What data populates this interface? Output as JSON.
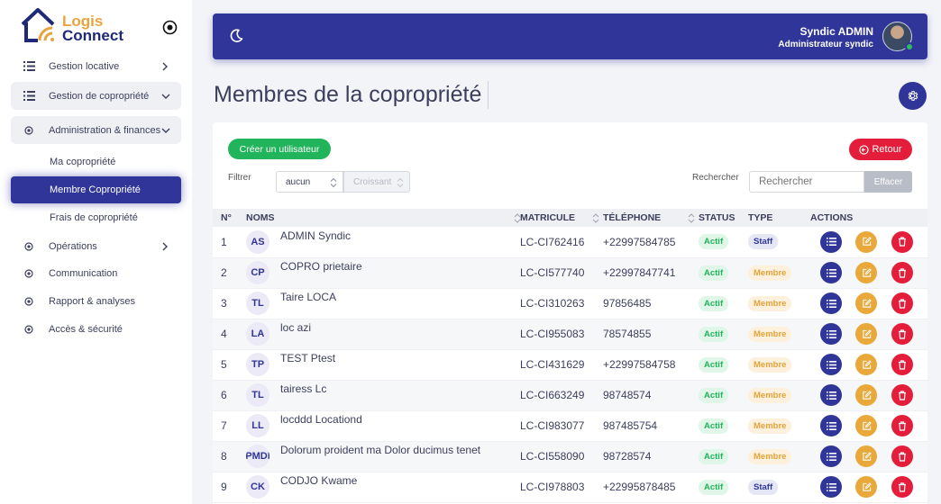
{
  "brand": {
    "line1": "Logis",
    "line2": "Connect"
  },
  "sidebar": {
    "items": [
      {
        "label": "Gestion locative"
      },
      {
        "label": "Gestion de copropriété"
      },
      {
        "label": "Administration & finances"
      },
      {
        "label": "Opérations"
      },
      {
        "label": "Communication"
      },
      {
        "label": "Rapport & analyses"
      },
      {
        "label": "Accès & sécurité"
      }
    ],
    "subitems": [
      {
        "label": "Ma copropriété"
      },
      {
        "label": "Membre Copropriété"
      },
      {
        "label": "Frais de copropriété"
      }
    ]
  },
  "header": {
    "user_name": "Syndic ADMIN",
    "user_role": "Administrateur syndic"
  },
  "page": {
    "title": "Membres de la copropriété"
  },
  "toolbar": {
    "create_label": "Créer un utilisateur",
    "back_label": "Retour",
    "filter_label": "Filtrer",
    "filter_value": "aucun",
    "order_value": "Croissant",
    "search_label": "Rechercher",
    "search_placeholder": "Rechercher",
    "clear_label": "Effacer"
  },
  "table": {
    "headers": [
      "N°",
      "NOMS",
      "MATRICULE",
      "TÉLÉPHONE",
      "STATUS",
      "TYPE",
      "ACTIONS"
    ],
    "rows": [
      {
        "num": "1",
        "initials": "AS",
        "name": "ADMIN Syndic",
        "matricule": "LC-CI762416",
        "phone": "+22997584785",
        "status": "Actif",
        "type": "Staff"
      },
      {
        "num": "2",
        "initials": "CP",
        "name": "COPRO prietaire",
        "matricule": "LC-CI577740",
        "phone": "+22997847741",
        "status": "Actif",
        "type": "Membre"
      },
      {
        "num": "3",
        "initials": "TL",
        "name": "Taire LOCA",
        "matricule": "LC-CI310263",
        "phone": "97856485",
        "status": "Actif",
        "type": "Membre"
      },
      {
        "num": "4",
        "initials": "LA",
        "name": "loc azi",
        "matricule": "LC-CI955083",
        "phone": "78574855",
        "status": "Actif",
        "type": "Membre"
      },
      {
        "num": "5",
        "initials": "TP",
        "name": "TEST Ptest",
        "matricule": "LC-CI431629",
        "phone": "+22997584758",
        "status": "Actif",
        "type": "Membre"
      },
      {
        "num": "6",
        "initials": "TL",
        "name": "tairess Lc",
        "matricule": "LC-CI663249",
        "phone": "98748574",
        "status": "Actif",
        "type": "Membre"
      },
      {
        "num": "7",
        "initials": "LL",
        "name": "locddd Locationd",
        "matricule": "LC-CI983077",
        "phone": "987485754",
        "status": "Actif",
        "type": "Membre"
      },
      {
        "num": "8",
        "initials": "PMDI",
        "name": "Dolorum proident ma Dolor ducimus tenet",
        "matricule": "LC-CI558090",
        "phone": "98728574",
        "status": "Actif",
        "type": "Membre"
      },
      {
        "num": "9",
        "initials": "CK",
        "name": "CODJO Kwame",
        "matricule": "LC-CI978803",
        "phone": "+22995878485",
        "status": "Actif",
        "type": "Staff"
      }
    ]
  },
  "colors": {
    "primary": "#2f3599",
    "success": "#22b45a",
    "danger": "#e41d3a",
    "warning": "#e9a83a",
    "brand_orange": "#e8a33d",
    "brand_navy": "#1e2a78"
  },
  "icons": [
    "house-logo-icon",
    "target-icon",
    "list-icon",
    "chevron-right-icon",
    "chevron-down-icon",
    "radio-icon",
    "moon-icon",
    "gear-icon",
    "arrow-left-circle-icon",
    "sort-icon",
    "edit-icon",
    "trash-icon"
  ]
}
